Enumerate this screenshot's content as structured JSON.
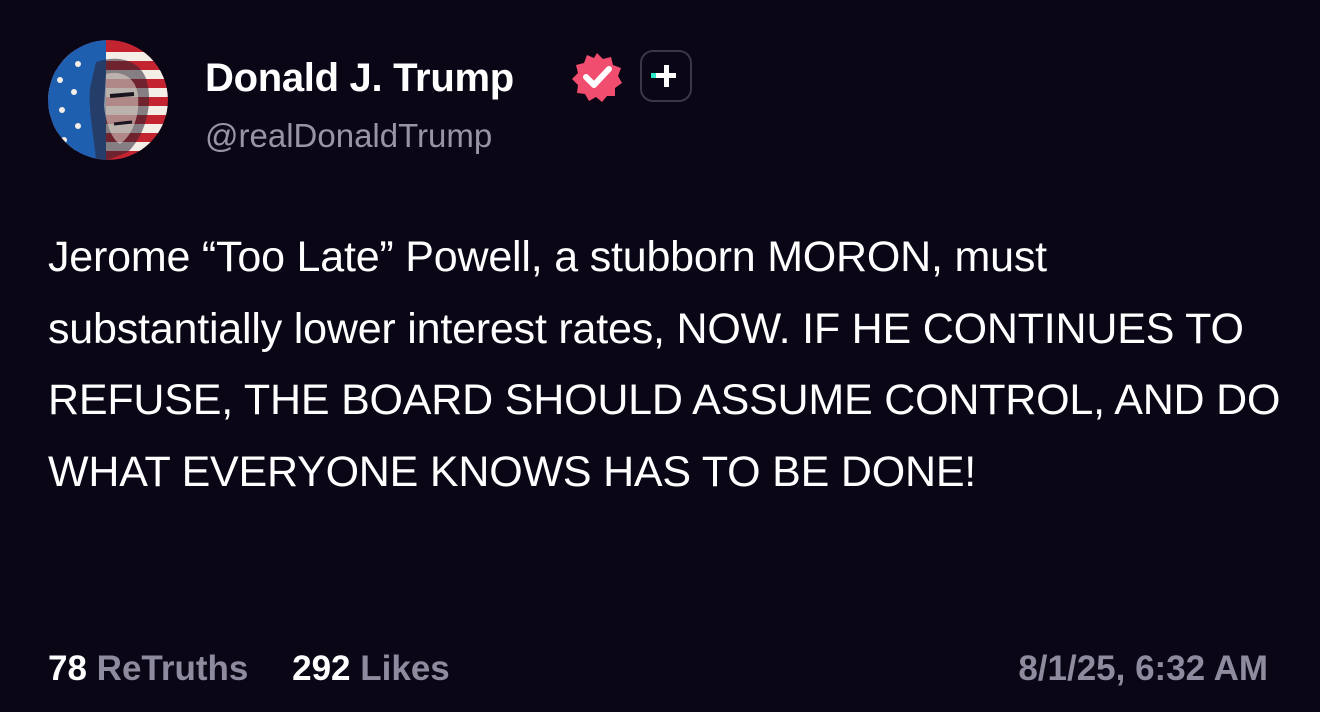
{
  "author": {
    "display_name": "Donald J. Trump",
    "handle": "@realDonaldTrump",
    "avatar_icon": "flag-portrait-avatar",
    "verified_icon": "verified-badge-icon",
    "plus_icon": "plus-subscription-icon"
  },
  "post": {
    "text": "Jerome “Too Late” Powell, a stubborn MORON, must substantially lower interest rates, NOW. IF HE CONTINUES TO REFUSE, THE BOARD SHOULD ASSUME CONTROL, AND DO WHAT EVERYONE KNOWS HAS TO BE DONE!"
  },
  "stats": {
    "retruths_count": "78",
    "retruths_label": "ReTruths",
    "likes_count": "292",
    "likes_label": "Likes"
  },
  "timestamp": "8/1/25, 6:32 AM",
  "colors": {
    "background": "#0a0616",
    "text": "#ffffff",
    "muted": "#8f8b9e",
    "verified_badge": "#f14d6e",
    "plus_accent": "#2ee6c8"
  }
}
